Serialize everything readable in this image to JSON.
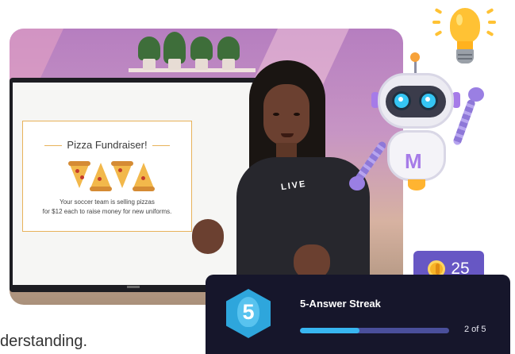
{
  "video": {
    "slide_title": "Pizza Fundraiser!",
    "slide_body_line1": "Your soccer team is selling pizzas",
    "slide_body_line2": "for $12 each to raise money for new uniforms.",
    "shirt_text": "LIVE"
  },
  "coin_badge": {
    "icon": "coin-icon",
    "count": "25"
  },
  "streak": {
    "number": "5",
    "title": "5-Answer Streak",
    "progress_text": "2 of 5",
    "progress_fraction": 0.4
  },
  "caption": {
    "text": "derstanding."
  },
  "colors": {
    "streak_card_bg": "#16162b",
    "coin_badge_bg": "#6757c4",
    "progress_fill": "#38b6f0",
    "hex_badge": "#2ea6dc"
  }
}
